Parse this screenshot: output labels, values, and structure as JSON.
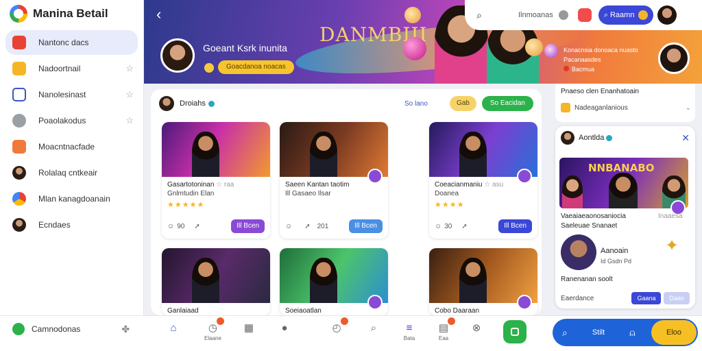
{
  "app": {
    "title": "Manina Betail"
  },
  "sidebar": {
    "items": [
      {
        "label": "Nantonc dacs",
        "icon": "tv-icon",
        "color": "#e94235",
        "active": true,
        "star": false
      },
      {
        "label": "Nadoortnail",
        "icon": "folder-icon",
        "color": "#f5b526",
        "active": false,
        "star": true
      },
      {
        "label": "Nanolesinast",
        "icon": "square-icon",
        "color": "#3b55c4",
        "active": false,
        "star": true
      },
      {
        "label": "Poaolakodus",
        "icon": "chat-icon",
        "color": "#9aa0a6",
        "active": false,
        "star": true
      },
      {
        "label": "Moacntnacfade",
        "icon": "bookmark-icon",
        "color": "#f07a3c",
        "active": false,
        "star": false
      },
      {
        "label": "Rolalaq cntkeair",
        "icon": "avatar-icon",
        "color": "#2b1d16",
        "active": false,
        "star": false
      },
      {
        "label": "Mlan kanagdoanain",
        "icon": "chrome-icon",
        "color": "#4285f4",
        "active": false,
        "star": false
      },
      {
        "label": "Ecndaes",
        "icon": "avatar-icon",
        "color": "#2b1d16",
        "active": false,
        "star": false
      }
    ]
  },
  "hero": {
    "name": "Goeant Ksrk inunita",
    "pill": "Goacdanoa noacas",
    "logo": "DANMBIII",
    "promo_line1": "Konacnsia donoaca nuasto",
    "promo_line2": "Pacanaasdes",
    "promo_line3": "Bacmua"
  },
  "topbar": {
    "text": "Ilnmoanas",
    "button": "Raamn"
  },
  "filter": {
    "name": "Droiahs",
    "link": "So lano",
    "chip": "Gab",
    "green": "So Eacidan"
  },
  "cards": [
    {
      "title": "Gasartotoninan",
      "title_meta": "☆ raa",
      "sub": "Gnlmtudin Elan",
      "stars": "★★★★★",
      "likes": "90",
      "shares": "",
      "btn": "Ill Bcen",
      "btn_color": "#8a4ad6",
      "img": "a"
    },
    {
      "title": "Saeen Kantan taotim",
      "title_meta": "",
      "sub": "Ill Gasaeo Ilsar",
      "stars": "",
      "likes": "",
      "shares": "201",
      "btn": "Ill Bcen",
      "btn_color": "#4a90e2",
      "img": "b"
    },
    {
      "title": "Coeacianmaniu",
      "title_meta": "☆ asu",
      "sub": "Doanea",
      "stars": "★★★★",
      "likes": "30",
      "shares": "",
      "btn": "Ill Bcen",
      "btn_color": "#3b47d6",
      "img": "c"
    },
    {
      "title": "Ganlaiaad",
      "title_meta": "",
      "sub": "",
      "stars": "",
      "likes": "",
      "shares": "",
      "btn": "",
      "btn_color": "#8a4ad6",
      "img": "d"
    },
    {
      "title": "Soeiaoatlan",
      "title_meta": "",
      "sub": "",
      "stars": "",
      "likes": "",
      "shares": "",
      "btn": "",
      "btn_color": "#8a4ad6",
      "img": "e"
    },
    {
      "title": "Cobo Daaraan",
      "title_meta": "",
      "sub": "",
      "stars": "",
      "likes": "",
      "shares": "",
      "btn": "",
      "btn_color": "#8a4ad6",
      "img": "f"
    }
  ],
  "side_top": {
    "line": "Pnaeso clen Enanhatoain",
    "row": "Nadeaganlanious"
  },
  "side_card": {
    "name": "Aontlda",
    "img_title": "NNBANABO",
    "text1": "Vaeaiaeaonosaniocia",
    "text1b": "Inaaesa",
    "text2": "Saeleuae Snanaet",
    "person_name": "Aanoain",
    "person_meta": "Id Gsdn Pd",
    "text3": "Ranenanan soolt",
    "foot_label": "Eaerdance",
    "btn1": "Gaana",
    "btn2": "Daan"
  },
  "bottombar": {
    "left_label": "Camnodonas",
    "items": [
      {
        "cap": "",
        "icon": "home-icon"
      },
      {
        "cap": "Elaane",
        "icon": "clock-icon",
        "notif": true
      },
      {
        "cap": "",
        "icon": "calendar-icon"
      },
      {
        "cap": "",
        "icon": "person-icon"
      },
      {
        "cap": "",
        "icon": "timer-icon",
        "notif": true
      },
      {
        "cap": "",
        "icon": "search-icon"
      },
      {
        "cap": "Bata",
        "icon": "layers-icon"
      },
      {
        "cap": "Eaa",
        "icon": "cart-icon",
        "notif": true
      },
      {
        "cap": "",
        "icon": "close-circle-icon"
      }
    ],
    "pill_text": "Stilt",
    "pill_btn": "Eloo"
  }
}
